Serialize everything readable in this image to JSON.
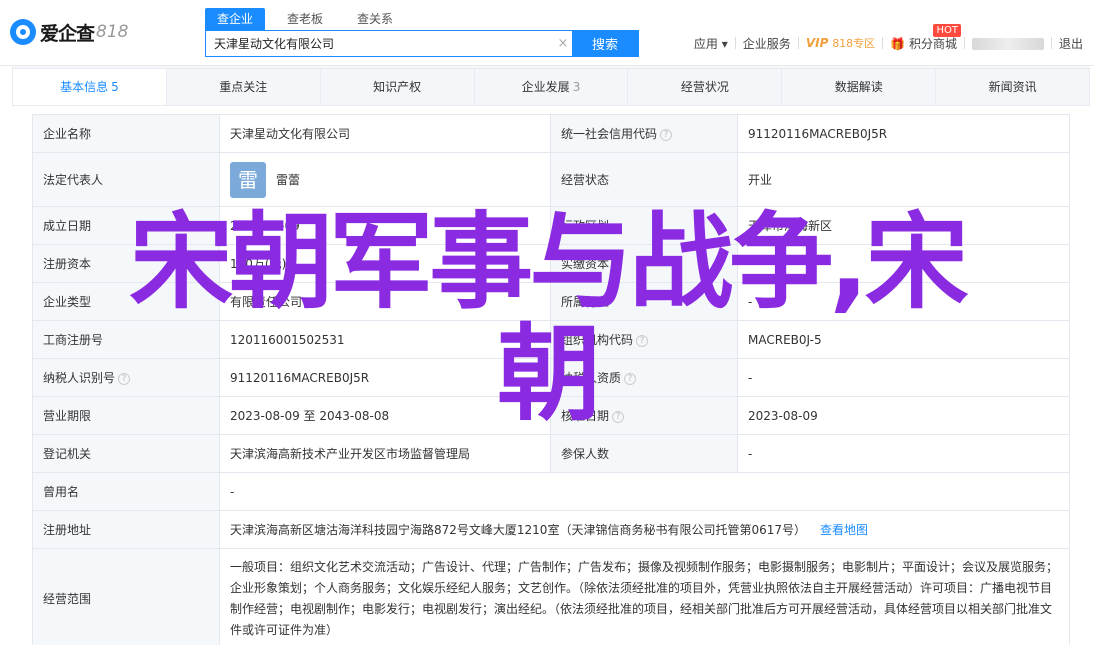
{
  "header": {
    "logo_text": "爱企查",
    "logo_num": "818",
    "search_tabs": [
      "查企业",
      "查老板",
      "查关系"
    ],
    "search_value": "天津星动文化有限公司",
    "search_button": "搜索",
    "nav": {
      "app": "应用",
      "service": "企业服务",
      "vip": "VIP",
      "vip_sub": "818专区",
      "points": "积分商城",
      "hot": "HOT",
      "logout": "退出"
    }
  },
  "tabs": [
    {
      "label": "基本信息",
      "count": "5"
    },
    {
      "label": "重点关注",
      "count": ""
    },
    {
      "label": "知识产权",
      "count": ""
    },
    {
      "label": "企业发展",
      "count": "3"
    },
    {
      "label": "经营状况",
      "count": ""
    },
    {
      "label": "数据解读",
      "count": ""
    },
    {
      "label": "新闻资讯",
      "count": ""
    }
  ],
  "info": {
    "company_name_label": "企业名称",
    "company_name": "天津星动文化有限公司",
    "credit_code_label": "统一社会信用代码",
    "credit_code": "91120116MACREB0J5R",
    "legal_rep_label": "法定代表人",
    "legal_rep_avatar": "雷",
    "legal_rep": "雷蕾",
    "status_label": "经营状态",
    "status": "开业",
    "founded_label": "成立日期",
    "founded": "2023-08-09",
    "region_label": "行政区划",
    "region": "天津市滨海新区",
    "reg_capital_label": "注册资本",
    "reg_capital": "100万(元)",
    "paid_capital_label": "实缴资本",
    "paid_capital": "-",
    "type_label": "企业类型",
    "type": "有限责任公司",
    "industry_label": "所属行业",
    "industry": "-",
    "reg_no_label": "工商注册号",
    "reg_no": "120116001502531",
    "org_code_label": "组织机构代码",
    "org_code": "MACREB0J-5",
    "tax_id_label": "纳税人识别号",
    "tax_id": "91120116MACREB0J5R",
    "qualification_label": "纳税人资质",
    "qualification": "-",
    "term_label": "营业期限",
    "term": "2023-08-09 至 2043-08-08",
    "approval_label": "核准日期",
    "approval": "2023-08-09",
    "authority_label": "登记机关",
    "authority": "天津滨海高新技术产业开发区市场监督管理局",
    "insured_label": "参保人数",
    "insured": "-",
    "former_name_label": "曾用名",
    "former_name": "-",
    "address_label": "注册地址",
    "address": "天津滨海高新区塘沽海洋科技园宁海路872号文峰大厦1210室（天津锦信商务秘书有限公司托管第0617号）",
    "map_link": "查看地图",
    "scope_label": "经营范围",
    "scope": "一般项目：组织文化艺术交流活动；广告设计、代理；广告制作；广告发布；摄像及视频制作服务；电影摄制服务；电影制片；平面设计；会议及展览服务；企业形象策划；个人商务服务；文化娱乐经纪人服务；文艺创作。（除依法须经批准的项目外，凭营业执照依法自主开展经营活动）许可项目：广播电视节目制作经营；电视剧制作；电影发行；电视剧发行；演出经纪。（依法须经批准的项目，经相关部门批准后方可开展经营活动，具体经营项目以相关部门批准文件或许可证件为准）"
  },
  "overlay": {
    "line1": "宋朝军事与战争,宋",
    "line2": "朝"
  },
  "colors": {
    "accent": "#1a8cff",
    "overlay": "#8a2be2",
    "vip": "#f2a03d"
  }
}
